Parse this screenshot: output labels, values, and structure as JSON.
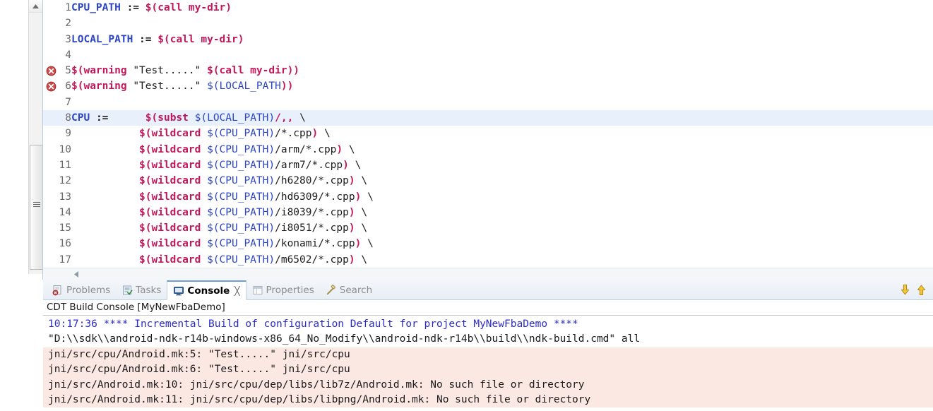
{
  "editor": {
    "current_line": 8,
    "highlight_color": "#e8f0fc",
    "lines": [
      {
        "n": "1",
        "marker": null,
        "tokens": [
          {
            "c": "t-var",
            "t": "CPU_PATH"
          },
          {
            "c": "t-plain",
            "t": " "
          },
          {
            "c": "t-op",
            "t": ":="
          },
          {
            "c": "t-plain",
            "t": " "
          },
          {
            "c": "t-fn",
            "t": "$(call my-dir)"
          }
        ]
      },
      {
        "n": "2",
        "marker": null,
        "tokens": []
      },
      {
        "n": "3",
        "marker": null,
        "tokens": [
          {
            "c": "t-var",
            "t": "LOCAL_PATH"
          },
          {
            "c": "t-plain",
            "t": " "
          },
          {
            "c": "t-op",
            "t": ":="
          },
          {
            "c": "t-plain",
            "t": " "
          },
          {
            "c": "t-fn",
            "t": "$(call my-dir)"
          }
        ]
      },
      {
        "n": "4",
        "marker": null,
        "tokens": []
      },
      {
        "n": "5",
        "marker": "error-icon",
        "tokens": [
          {
            "c": "t-fn",
            "t": "$(warning"
          },
          {
            "c": "t-plain",
            "t": " "
          },
          {
            "c": "t-str",
            "t": "\"Test.....\""
          },
          {
            "c": "t-plain",
            "t": " "
          },
          {
            "c": "t-fn",
            "t": "$(call my-dir))"
          }
        ]
      },
      {
        "n": "6",
        "marker": "error-icon",
        "tokens": [
          {
            "c": "t-fn",
            "t": "$(warning"
          },
          {
            "c": "t-plain",
            "t": " "
          },
          {
            "c": "t-str",
            "t": "\"Test.....\""
          },
          {
            "c": "t-plain",
            "t": " "
          },
          {
            "c": "t-ref",
            "t": "$(LOCAL_PATH"
          },
          {
            "c": "t-fn",
            "t": "))"
          }
        ]
      },
      {
        "n": "7",
        "marker": null,
        "tokens": []
      },
      {
        "n": "8",
        "marker": null,
        "tokens": [
          {
            "c": "t-var",
            "t": "CPU"
          },
          {
            "c": "t-plain",
            "t": " "
          },
          {
            "c": "t-op",
            "t": ":="
          },
          {
            "c": "t-plain",
            "t": "      "
          },
          {
            "c": "t-fn",
            "t": "$(subst"
          },
          {
            "c": "t-plain",
            "t": " "
          },
          {
            "c": "t-ref",
            "t": "$(LOCAL_PATH)"
          },
          {
            "c": "t-fn",
            "t": "/,,"
          },
          {
            "c": "t-plain",
            "t": " \\"
          }
        ]
      },
      {
        "n": "9",
        "marker": null,
        "tokens": [
          {
            "c": "t-plain",
            "t": "           "
          },
          {
            "c": "t-fn",
            "t": "$(wildcard"
          },
          {
            "c": "t-plain",
            "t": " "
          },
          {
            "c": "t-ref",
            "t": "$(CPU_PATH)"
          },
          {
            "c": "t-plain",
            "t": "/*.cpp"
          },
          {
            "c": "t-fn",
            "t": ")"
          },
          {
            "c": "t-plain",
            "t": " \\"
          }
        ]
      },
      {
        "n": "10",
        "marker": null,
        "tokens": [
          {
            "c": "t-plain",
            "t": "           "
          },
          {
            "c": "t-fn",
            "t": "$(wildcard"
          },
          {
            "c": "t-plain",
            "t": " "
          },
          {
            "c": "t-ref",
            "t": "$(CPU_PATH)"
          },
          {
            "c": "t-plain",
            "t": "/arm/*.cpp"
          },
          {
            "c": "t-fn",
            "t": ")"
          },
          {
            "c": "t-plain",
            "t": " \\"
          }
        ]
      },
      {
        "n": "11",
        "marker": null,
        "tokens": [
          {
            "c": "t-plain",
            "t": "           "
          },
          {
            "c": "t-fn",
            "t": "$(wildcard"
          },
          {
            "c": "t-plain",
            "t": " "
          },
          {
            "c": "t-ref",
            "t": "$(CPU_PATH)"
          },
          {
            "c": "t-plain",
            "t": "/arm7/*.cpp"
          },
          {
            "c": "t-fn",
            "t": ")"
          },
          {
            "c": "t-plain",
            "t": " \\"
          }
        ]
      },
      {
        "n": "12",
        "marker": null,
        "tokens": [
          {
            "c": "t-plain",
            "t": "           "
          },
          {
            "c": "t-fn",
            "t": "$(wildcard"
          },
          {
            "c": "t-plain",
            "t": " "
          },
          {
            "c": "t-ref",
            "t": "$(CPU_PATH)"
          },
          {
            "c": "t-plain",
            "t": "/h6280/*.cpp"
          },
          {
            "c": "t-fn",
            "t": ")"
          },
          {
            "c": "t-plain",
            "t": " \\"
          }
        ]
      },
      {
        "n": "13",
        "marker": null,
        "tokens": [
          {
            "c": "t-plain",
            "t": "           "
          },
          {
            "c": "t-fn",
            "t": "$(wildcard"
          },
          {
            "c": "t-plain",
            "t": " "
          },
          {
            "c": "t-ref",
            "t": "$(CPU_PATH)"
          },
          {
            "c": "t-plain",
            "t": "/hd6309/*.cpp"
          },
          {
            "c": "t-fn",
            "t": ")"
          },
          {
            "c": "t-plain",
            "t": " \\"
          }
        ]
      },
      {
        "n": "14",
        "marker": null,
        "tokens": [
          {
            "c": "t-plain",
            "t": "           "
          },
          {
            "c": "t-fn",
            "t": "$(wildcard"
          },
          {
            "c": "t-plain",
            "t": " "
          },
          {
            "c": "t-ref",
            "t": "$(CPU_PATH)"
          },
          {
            "c": "t-plain",
            "t": "/i8039/*.cpp"
          },
          {
            "c": "t-fn",
            "t": ")"
          },
          {
            "c": "t-plain",
            "t": " \\"
          }
        ]
      },
      {
        "n": "15",
        "marker": null,
        "tokens": [
          {
            "c": "t-plain",
            "t": "           "
          },
          {
            "c": "t-fn",
            "t": "$(wildcard"
          },
          {
            "c": "t-plain",
            "t": " "
          },
          {
            "c": "t-ref",
            "t": "$(CPU_PATH)"
          },
          {
            "c": "t-plain",
            "t": "/i8051/*.cpp"
          },
          {
            "c": "t-fn",
            "t": ")"
          },
          {
            "c": "t-plain",
            "t": " \\"
          }
        ]
      },
      {
        "n": "16",
        "marker": null,
        "tokens": [
          {
            "c": "t-plain",
            "t": "           "
          },
          {
            "c": "t-fn",
            "t": "$(wildcard"
          },
          {
            "c": "t-plain",
            "t": " "
          },
          {
            "c": "t-ref",
            "t": "$(CPU_PATH)"
          },
          {
            "c": "t-plain",
            "t": "/konami/*.cpp"
          },
          {
            "c": "t-fn",
            "t": ")"
          },
          {
            "c": "t-plain",
            "t": " \\"
          }
        ]
      },
      {
        "n": "17",
        "marker": null,
        "tokens": [
          {
            "c": "t-plain",
            "t": "           "
          },
          {
            "c": "t-fn",
            "t": "$(wildcard"
          },
          {
            "c": "t-plain",
            "t": " "
          },
          {
            "c": "t-ref",
            "t": "$(CPU_PATH)"
          },
          {
            "c": "t-plain",
            "t": "/m6502/*.cpp"
          },
          {
            "c": "t-fn",
            "t": ")"
          },
          {
            "c": "t-plain",
            "t": " \\"
          }
        ]
      }
    ]
  },
  "bottom_panel": {
    "tabs": [
      {
        "label": "Problems",
        "icon": "problems-icon",
        "active": false,
        "closeable": false
      },
      {
        "label": "Tasks",
        "icon": "tasks-icon",
        "active": false,
        "closeable": false
      },
      {
        "label": "Console",
        "icon": "console-icon",
        "active": true,
        "closeable": true
      },
      {
        "label": "Properties",
        "icon": "properties-icon",
        "active": false,
        "closeable": false
      },
      {
        "label": "Search",
        "icon": "search-icon",
        "active": false,
        "closeable": false
      }
    ],
    "tools": [
      {
        "name": "scroll-down-icon",
        "color": "#f0b429"
      },
      {
        "name": "scroll-up-icon",
        "color": "#f0b429"
      }
    ],
    "console_title": "CDT Build Console [MyNewFbaDemo]",
    "console_lines": [
      {
        "kind": "info",
        "text": "10:17:36 **** Incremental Build of configuration Default for project MyNewFbaDemo ****"
      },
      {
        "kind": "plain",
        "text": "\"D:\\\\sdk\\\\android-ndk-r14b-windows-x86_64_No_Modify\\\\android-ndk-r14b\\\\build\\\\ndk-build.cmd\" all"
      },
      {
        "kind": "err",
        "text": "jni/src/cpu/Android.mk:5: \"Test.....\" jni/src/cpu"
      },
      {
        "kind": "err",
        "text": "jni/src/cpu/Android.mk:6: \"Test.....\" jni/src/cpu"
      },
      {
        "kind": "err",
        "text": "jni/src/Android.mk:10: jni/src/cpu/dep/libs/lib7z/Android.mk: No such file or directory"
      },
      {
        "kind": "err",
        "text": "jni/src/Android.mk:11: jni/src/cpu/dep/libs/libpng/Android.mk: No such file or directory"
      }
    ]
  },
  "colors": {
    "error_bg": "#fce8e3",
    "info_text": "#2b2bcc",
    "makefile_function": "#c2185b",
    "makefile_variable": "#2b45c6",
    "current_line": "#e8f0fc",
    "tab_active_border": "#6a9fd4"
  }
}
